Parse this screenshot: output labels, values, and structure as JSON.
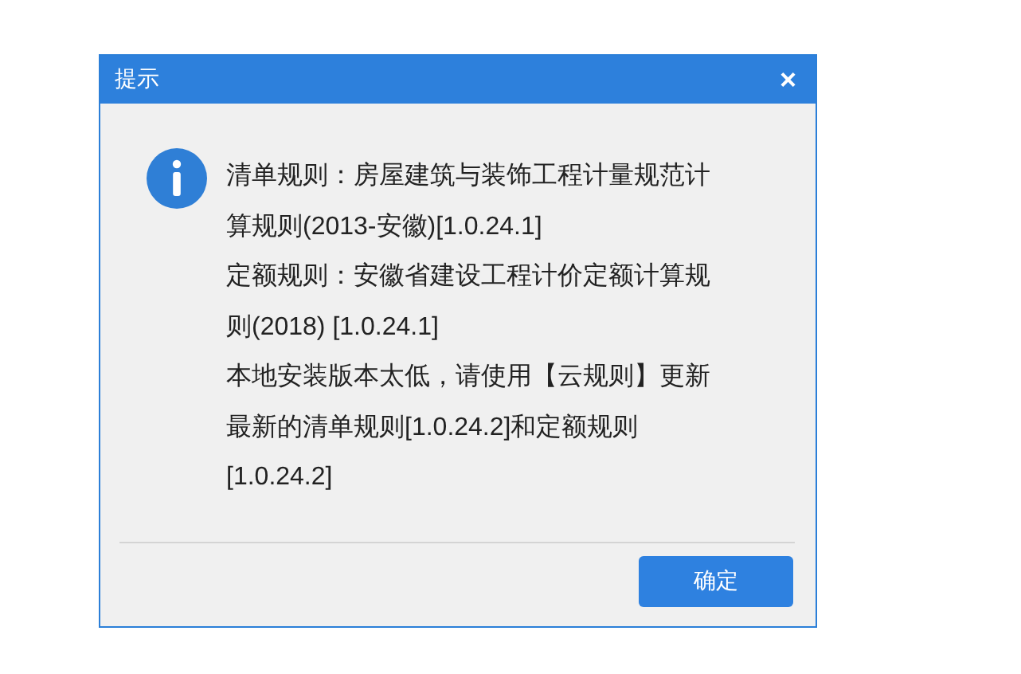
{
  "window": {
    "title": "提示",
    "close": "×"
  },
  "message_lines": [
    "清单规则：房屋建筑与装饰工程计量规范计",
    "算规则(2013-安徽)[1.0.24.1]",
    "定额规则：安徽省建设工程计价定额计算规",
    "则(2018) [1.0.24.1]",
    "本地安装版本太低，请使用【云规则】更新",
    "最新的清单规则[1.0.24.2]和定额规则",
    "[1.0.24.2]"
  ],
  "buttons": [
    "确定"
  ]
}
